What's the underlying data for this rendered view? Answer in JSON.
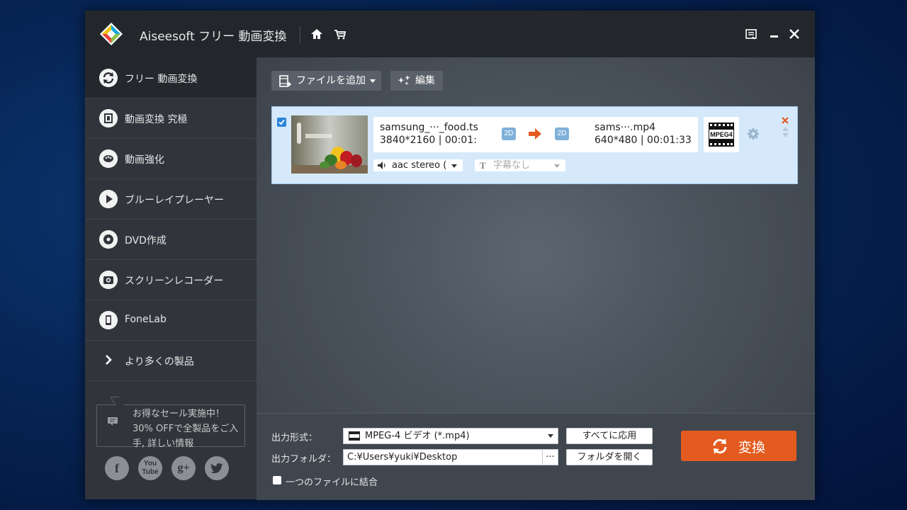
{
  "app": {
    "title": "Aiseesoft フリー 動画変換"
  },
  "sidebar": {
    "items": [
      {
        "label": "フリー 動画変換",
        "icon": "convert-icon"
      },
      {
        "label": "動画変換 究極",
        "icon": "film-icon"
      },
      {
        "label": "動画強化",
        "icon": "palette-icon"
      },
      {
        "label": "ブルーレイプレーヤー",
        "icon": "play-icon"
      },
      {
        "label": "DVD作成",
        "icon": "disc-icon"
      },
      {
        "label": "スクリーンレコーダー",
        "icon": "camera-icon"
      },
      {
        "label": "FoneLab",
        "icon": "phone-icon"
      },
      {
        "label": "より多くの製品",
        "icon": "chevron-right-icon"
      }
    ],
    "promo": "お得なセール実施中！30% OFFで全製品をご入手, 詳しい情報"
  },
  "toolbar": {
    "add_file": "ファイルを追加",
    "edit": "編集"
  },
  "file": {
    "source_name": "samsung_···_food.ts",
    "source_meta": "3840*2160 | 00:01:",
    "tag_in": "2D",
    "tag_out": "2D",
    "output_name": "sams···.mp4",
    "output_meta": "640*480 | 00:01:33",
    "format_badge": "MPEG4",
    "audio": "aac stereo (",
    "subtitle": "字幕なし",
    "checked": true
  },
  "bottom": {
    "format_label": "出力形式：",
    "format_value": "MPEG-4 ビデオ (*.mp4)",
    "apply_all": "すべてに応用",
    "folder_label": "出力フォルダ：",
    "folder_value": "C:¥Users¥yuki¥Desktop",
    "browse": "···",
    "open_folder": "フォルダを開く",
    "merge_label": "一つのファイルに結合",
    "convert_label": "変換"
  },
  "colors": {
    "accent": "#e35b1f",
    "selection": "#d5e9fb",
    "check": "#2b84d8"
  }
}
